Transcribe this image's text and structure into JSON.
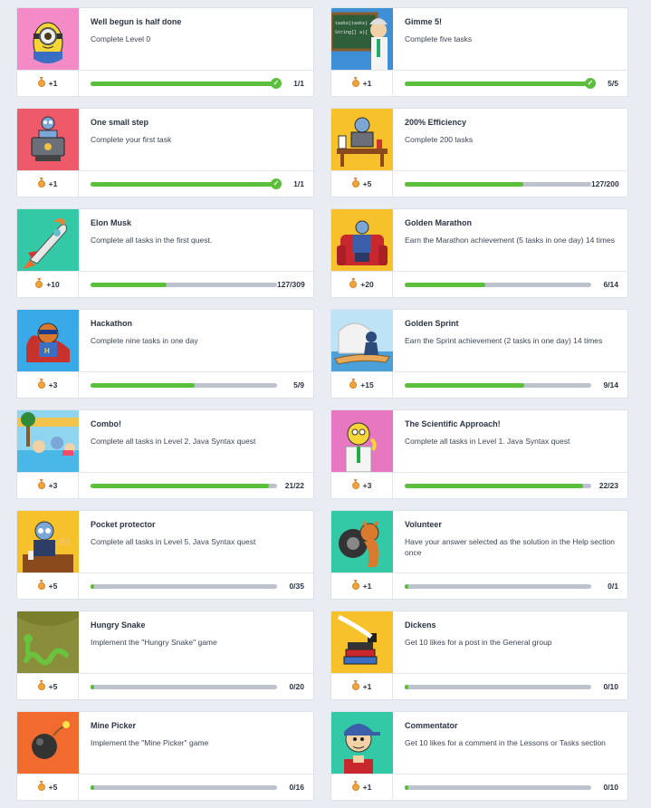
{
  "achievements": [
    {
      "title": "Well begun is half done",
      "description": "Complete Level 0",
      "reward": "+1",
      "progress": "1/1",
      "fraction": 1.0,
      "completed": true,
      "image": "minion-icon",
      "bg": "#f48ac6"
    },
    {
      "title": "Gimme 5!",
      "description": "Complete five tasks",
      "reward": "+1",
      "progress": "5/5",
      "fraction": 1.0,
      "completed": true,
      "image": "professor-blackboard-icon",
      "bg": "#3f8fd6"
    },
    {
      "title": "One small step",
      "description": "Complete your first task",
      "reward": "+1",
      "progress": "1/1",
      "fraction": 1.0,
      "completed": true,
      "image": "robot-laptop-icon",
      "bg": "#ef5a6a"
    },
    {
      "title": "200% Efficiency",
      "description": "Complete 200 tasks",
      "reward": "+5",
      "progress": "127/200",
      "fraction": 0.635,
      "completed": false,
      "image": "robot-desk-icon",
      "bg": "#f7c12b"
    },
    {
      "title": "Elon Musk",
      "description": "Complete all tasks in the first quest.",
      "reward": "+10",
      "progress": "127/309",
      "fraction": 0.41,
      "completed": false,
      "image": "rocket-icon",
      "bg": "#33c9a6"
    },
    {
      "title": "Golden Marathon",
      "description": "Earn the Marathon achievement (5 tasks in one day) 14 times",
      "reward": "+20",
      "progress": "6/14",
      "fraction": 0.43,
      "completed": false,
      "image": "robot-armchair-icon",
      "bg": "#f7c12b"
    },
    {
      "title": "Hackathon",
      "description": "Complete nine tasks in one day",
      "reward": "+3",
      "progress": "5/9",
      "fraction": 0.56,
      "completed": false,
      "image": "hero-cat-icon",
      "bg": "#3aa9e8"
    },
    {
      "title": "Golden Sprint",
      "description": "Earn the Sprint achievement (2 tasks in one day) 14 times",
      "reward": "+15",
      "progress": "9/14",
      "fraction": 0.64,
      "completed": false,
      "image": "surfing-robot-icon",
      "bg": "#bfe3f6"
    },
    {
      "title": "Combo!",
      "description": "Complete all tasks in Level 2. Java Syntax quest",
      "reward": "+3",
      "progress": "21/22",
      "fraction": 0.955,
      "completed": false,
      "image": "pool-party-icon",
      "bg": "#8fd5f0"
    },
    {
      "title": "The Scientific Approach!",
      "description": "Complete all tasks in Level 1. Java Syntax quest",
      "reward": "+3",
      "progress": "22/23",
      "fraction": 0.957,
      "completed": false,
      "image": "scientist-icon",
      "bg": "#e777c0"
    },
    {
      "title": "Pocket protector",
      "description": "Complete all tasks in Level 5. Java Syntax quest",
      "reward": "+5",
      "progress": "0/35",
      "fraction": 0.0,
      "completed": false,
      "image": "robot-boss-icon",
      "bg": "#f7c12b"
    },
    {
      "title": "Volunteer",
      "description": "Have your answer selected as the solution in the Help section once",
      "reward": "+1",
      "progress": "0/1",
      "fraction": 0.0,
      "completed": false,
      "image": "cat-tire-icon",
      "bg": "#33c9a6"
    },
    {
      "title": "Hungry Snake",
      "description": "Implement the \"Hungry Snake\" game",
      "reward": "+5",
      "progress": "0/20",
      "fraction": 0.0,
      "completed": false,
      "image": "snake-icon",
      "bg": "#7a7f2e"
    },
    {
      "title": "Dickens",
      "description": "Get 10 likes for a post in the General group",
      "reward": "+1",
      "progress": "0/10",
      "fraction": 0.0,
      "completed": false,
      "image": "quill-books-icon",
      "bg": "#f7c12b"
    },
    {
      "title": "Mine Picker",
      "description": "Implement the \"Mine Picker\" game",
      "reward": "+5",
      "progress": "0/16",
      "fraction": 0.0,
      "completed": false,
      "image": "bomb-icon",
      "bg": "#f26b2e"
    },
    {
      "title": "Commentator",
      "description": "Get 10 likes for a comment in the Lessons or Tasks section",
      "reward": "+1",
      "progress": "0/10",
      "fraction": 0.0,
      "completed": false,
      "image": "cap-boy-icon",
      "bg": "#33c9a6"
    }
  ]
}
